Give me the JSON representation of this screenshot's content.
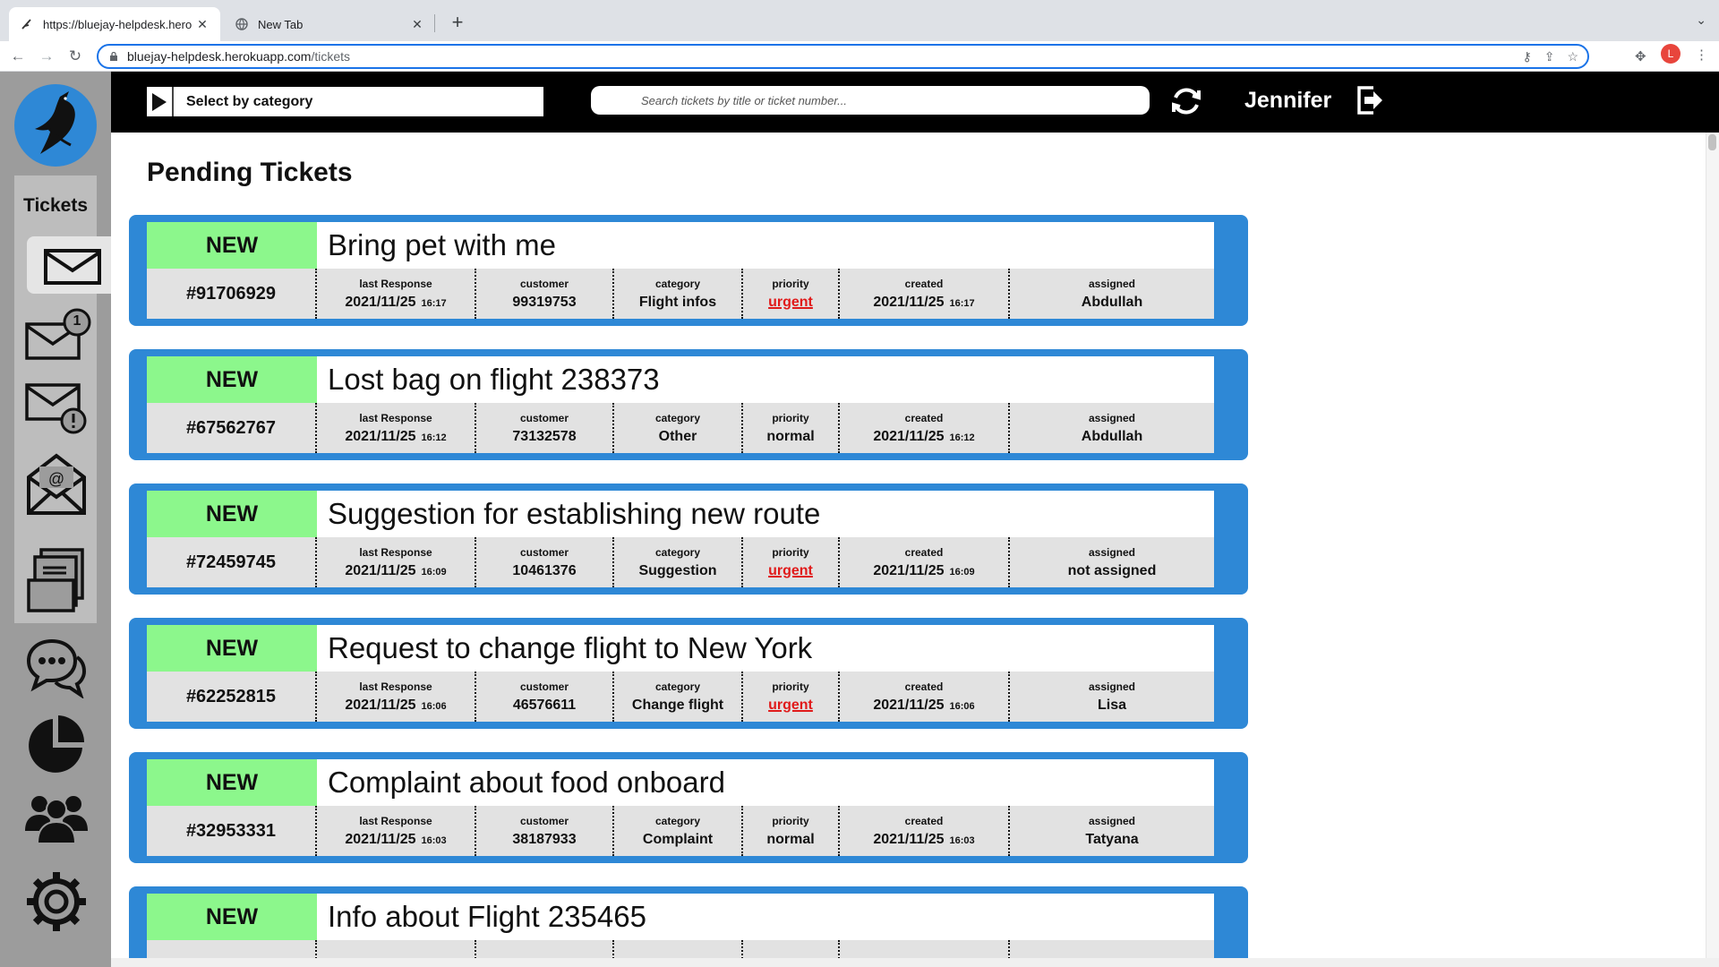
{
  "browser": {
    "tabs": [
      {
        "title": "https://bluejay-helpdesk.herok",
        "active": true
      },
      {
        "title": "New Tab",
        "active": false
      }
    ],
    "url_host": "bluejay-helpdesk.herokuapp.com",
    "url_path": "/tickets",
    "profile_initial": "L"
  },
  "sidebar": {
    "section_label": "Tickets",
    "unread_count": "1"
  },
  "topbar": {
    "category_label": "Select by category",
    "search_placeholder": "Search tickets by title or ticket number...",
    "username": "Jennifer"
  },
  "page": {
    "title": "Pending Tickets",
    "field_labels": {
      "last_response": "last Response",
      "customer": "customer",
      "category": "category",
      "priority": "priority",
      "created": "created",
      "assigned": "assigned"
    }
  },
  "tickets": [
    {
      "status": "NEW",
      "number": "#91706929",
      "title": "Bring pet with me",
      "last_response_date": "2021/11/25",
      "last_response_time": "16:17",
      "customer": "99319753",
      "category": "Flight infos",
      "priority": "urgent",
      "created_date": "2021/11/25",
      "created_time": "16:17",
      "assigned": "Abdullah"
    },
    {
      "status": "NEW",
      "number": "#67562767",
      "title": "Lost bag on flight 238373",
      "last_response_date": "2021/11/25",
      "last_response_time": "16:12",
      "customer": "73132578",
      "category": "Other",
      "priority": "normal",
      "created_date": "2021/11/25",
      "created_time": "16:12",
      "assigned": "Abdullah"
    },
    {
      "status": "NEW",
      "number": "#72459745",
      "title": "Suggestion for establishing new route",
      "last_response_date": "2021/11/25",
      "last_response_time": "16:09",
      "customer": "10461376",
      "category": "Suggestion",
      "priority": "urgent",
      "created_date": "2021/11/25",
      "created_time": "16:09",
      "assigned": "not assigned"
    },
    {
      "status": "NEW",
      "number": "#62252815",
      "title": "Request to change flight to New York",
      "last_response_date": "2021/11/25",
      "last_response_time": "16:06",
      "customer": "46576611",
      "category": "Change flight",
      "priority": "urgent",
      "created_date": "2021/11/25",
      "created_time": "16:06",
      "assigned": "Lisa"
    },
    {
      "status": "NEW",
      "number": "#32953331",
      "title": "Complaint about food onboard",
      "last_response_date": "2021/11/25",
      "last_response_time": "16:03",
      "customer": "38187933",
      "category": "Complaint",
      "priority": "normal",
      "created_date": "2021/11/25",
      "created_time": "16:03",
      "assigned": "Tatyana"
    },
    {
      "status": "NEW",
      "title": "Info about Flight 235465"
    }
  ],
  "colors": {
    "accent_blue": "#2e88d6",
    "new_badge": "#8cf78c",
    "urgent": "#e01a1a",
    "sidebar": "#9c9c9c"
  }
}
